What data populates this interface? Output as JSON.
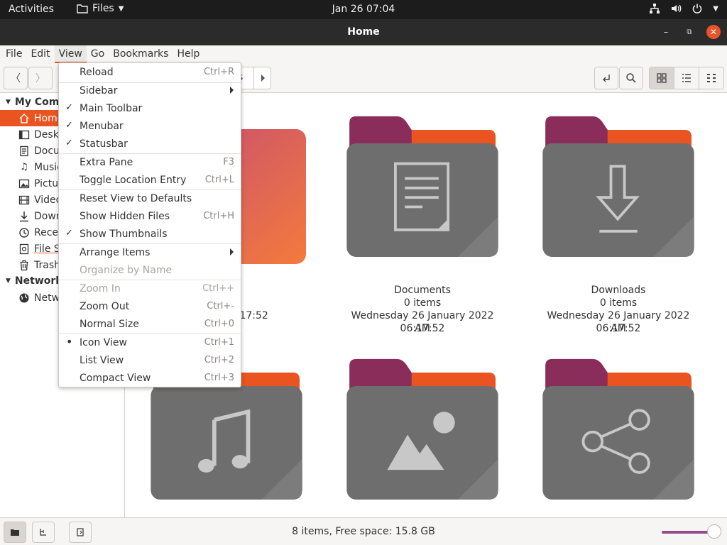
{
  "topbar": {
    "activities": "Activities",
    "app_name": "Files",
    "clock": "Jan 26  07:04"
  },
  "window": {
    "title": "Home"
  },
  "menubar": {
    "items": [
      "File",
      "Edit",
      "View",
      "Go",
      "Bookmarks",
      "Help"
    ],
    "active": "View"
  },
  "pathbar": {
    "partial_label": "s"
  },
  "sidebar": {
    "sections": [
      {
        "label": "My Comp",
        "items": [
          {
            "label": "Home",
            "icon": "home-icon",
            "selected": true
          },
          {
            "label": "Deskt",
            "icon": "desktop-icon"
          },
          {
            "label": "Docu",
            "icon": "document-icon"
          },
          {
            "label": "Music",
            "icon": "music-icon"
          },
          {
            "label": "Pictu",
            "icon": "picture-icon"
          },
          {
            "label": "Video",
            "icon": "video-icon"
          },
          {
            "label": "Down",
            "icon": "download-icon"
          },
          {
            "label": "Recen",
            "icon": "recent-icon"
          },
          {
            "label": "File S",
            "icon": "filesystem-icon"
          },
          {
            "label": "Trash",
            "icon": "trash-icon"
          }
        ]
      },
      {
        "label": "Network",
        "items": [
          {
            "label": "Netw",
            "icon": "network-icon"
          }
        ]
      }
    ]
  },
  "files": [
    {
      "name": "p",
      "count": "s",
      "date": "y 2022 06:17:52",
      "icon": "desktop-folder-icon"
    },
    {
      "name": "Documents",
      "count": "0 items",
      "date": "Wednesday 26 January 2022 06:17:52",
      "date2": "AM",
      "icon": "documents-folder-icon"
    },
    {
      "name": "Downloads",
      "count": "0 items",
      "date": "Wednesday 26 January 2022 06:17:52",
      "date2": "AM",
      "icon": "downloads-folder-icon"
    },
    {
      "icon": "music-folder-icon"
    },
    {
      "icon": "pictures-folder-icon"
    },
    {
      "icon": "public-folder-icon"
    }
  ],
  "view_menu": {
    "items": [
      {
        "label": "Reload",
        "accel": "Ctrl+R"
      },
      {
        "label": "Sidebar",
        "submenu": true
      },
      {
        "label": "Main Toolbar",
        "checked": true
      },
      {
        "label": "Menubar",
        "checked": true
      },
      {
        "label": "Statusbar",
        "checked": true
      },
      {
        "label": "Extra Pane",
        "accel": "F3"
      },
      {
        "label": "Toggle Location Entry",
        "accel": "Ctrl+L"
      },
      {
        "label": "Reset View to Defaults"
      },
      {
        "label": "Show Hidden Files",
        "accel": "Ctrl+H"
      },
      {
        "label": "Show Thumbnails",
        "checked": true
      },
      {
        "label": "Arrange Items",
        "submenu": true
      },
      {
        "label": "Organize by Name",
        "disabled": true
      },
      {
        "label": "Zoom In",
        "accel": "Ctrl++",
        "disabled": true
      },
      {
        "label": "Zoom Out",
        "accel": "Ctrl+-"
      },
      {
        "label": "Normal Size",
        "accel": "Ctrl+0"
      },
      {
        "label": "Icon View",
        "accel": "Ctrl+1",
        "radio": true
      },
      {
        "label": "List View",
        "accel": "Ctrl+2"
      },
      {
        "label": "Compact View",
        "accel": "Ctrl+3"
      }
    ]
  },
  "statusbar": {
    "text": "8 items, Free space: 15.8 GB",
    "zoom_level": 0.95
  },
  "colors": {
    "accent": "#e95420",
    "folder_body": "#6e6e6e",
    "folder_tab": "#e95420",
    "folder_tab_dark": "#772953",
    "slider": "#924d8b"
  }
}
